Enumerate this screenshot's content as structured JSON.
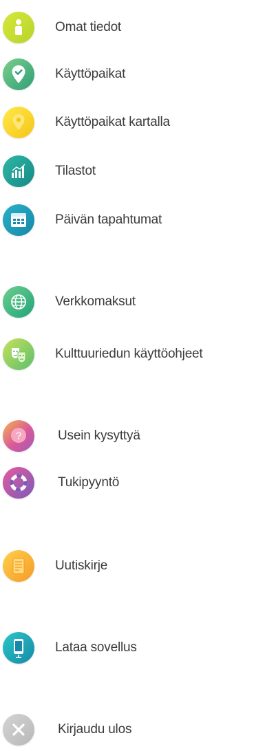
{
  "menu": {
    "items": [
      {
        "label": "Omat tiedot",
        "icon": "user-icon",
        "color": "#c9de33"
      },
      {
        "label": "Käyttöpaikat",
        "icon": "location-check-icon",
        "color": "#3fae7c"
      },
      {
        "label": "Käyttöpaikat kartalla",
        "icon": "map-pin-icon",
        "color": "#f8d62a"
      },
      {
        "label": "Tilastot",
        "icon": "bar-chart-icon",
        "color": "#1f9f95"
      },
      {
        "label": "Päivän tapahtumat",
        "icon": "calendar-icon",
        "color": "#1f9cb8"
      },
      {
        "label": "Verkkomaksut",
        "icon": "globe-icon",
        "color": "#3cb57f"
      },
      {
        "label": "Kulttuuriedun käyttöohjeet",
        "icon": "theater-masks-info-icon",
        "color": "#8ccc62"
      },
      {
        "label": "Usein kysyttyä",
        "icon": "question-bubble-icon",
        "color": "#dc6a8e"
      },
      {
        "label": "Tukipyyntö",
        "icon": "lifebuoy-icon",
        "color": "#b45aa8"
      },
      {
        "label": "Uutiskirje",
        "icon": "newsletter-icon",
        "color": "#f8b53a"
      },
      {
        "label": "Lataa sovellus",
        "icon": "mobile-app-icon",
        "color": "#20a8b8"
      },
      {
        "label": "Kirjaudu ulos",
        "icon": "close-icon",
        "color": "#c6c6c6"
      }
    ]
  }
}
